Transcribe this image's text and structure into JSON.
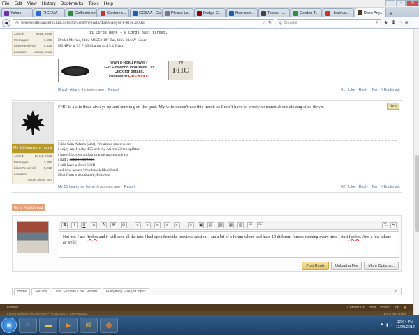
{
  "menubar": {
    "items": [
      "File",
      "Edit",
      "View",
      "History",
      "Bookmarks",
      "Tools",
      "Help"
    ]
  },
  "tabs": [
    {
      "label": "Yahoo",
      "color": "#6f2da8"
    },
    {
      "label": "RICEMA",
      "color": "#2a6ad8"
    },
    {
      "label": "Golftechi.net",
      "color": "#2f8d3a"
    },
    {
      "label": "Conferen...",
      "color": "#c0392b"
    },
    {
      "label": "GCSAA - Golf...",
      "color": "#1f5fa6"
    },
    {
      "label": "Please Lo...",
      "color": "#7a7a7a"
    },
    {
      "label": "Dodge C...",
      "color": "#8b0000"
    },
    {
      "label": "New cont...",
      "color": "#1f5fa6"
    },
    {
      "label": "Topics - ...",
      "color": "#444"
    },
    {
      "label": "Garden T...",
      "color": "#2f8d3a"
    },
    {
      "label": "Health.c...",
      "color": "#c0392b"
    },
    {
      "label": "Does Any...",
      "color": "#4f3a21",
      "active": true
    }
  ],
  "navbar": {
    "url": "firewoodhoardersclub.com/forums/threads/does-anyone-else.8082/",
    "search_placeholder": "Google"
  },
  "post_top": {
    "stats": [
      {
        "label": "Joined:",
        "value": "Oct 3, 2013"
      },
      {
        "label": "Messages:",
        "value": "7,605"
      },
      {
        "label": "Likes Received:",
        "value": "9,436"
      },
      {
        "label": "Location:",
        "value": "Lakota, Iowa"
      }
    ],
    "sig_lines": [
      "11 Cords done - 0 Cords past target.",
      "Drolet Myriad, Stihl MS250 18\" Bar, Stihl 034AV Super",
      "HENRY- a '99 F-150 Lariat 4x4 5.4 Triton"
    ],
    "banner": {
      "line1": "Own a Roku Player?",
      "line2": "Get Firewood Hoarders TV!",
      "line3": "Click for details.",
      "code_label": "codeword:",
      "code": "FIREWOOD",
      "tv_text": "TV",
      "fhc_text": "FHC"
    },
    "author": "Grizzly Adam",
    "time": "8 minutes ago",
    "report": "Report",
    "post_number": "#1",
    "like": "Like",
    "reply": "Reply",
    "top": "Top",
    "bookmark": "Bookmark"
  },
  "post_mid": {
    "username": "My 15 hearts my home",
    "stats": [
      {
        "label": "Joined:",
        "value": "Dec 1, 2013"
      },
      {
        "label": "Messages:",
        "value": "3,596"
      },
      {
        "label": "Likes Received:",
        "value": "5,213"
      },
      {
        "label": "Location:",
        "value": ""
      }
    ],
    "location_value": "South Shore, MA",
    "badge_new": "New",
    "body": "FHC is a site thats always up and running on the ipad. My wife doesn't use this much so I don't have to worry so much about closing sites down.",
    "sig_lines": [
      "I like Sam Adams (alot), I'm also a shareholder",
      "I enjoy my Husky 455 and my Ariens 22 ton splitter",
      "I have 2 boxers and an orange marmalade cat",
      "I had a Jotul F500 Oslo",
      "I still have a Jotul 602B",
      "and now have a Woodstock Ideal Steel",
      "Heat from a woodstove; Priceless"
    ],
    "author": "My 15 hearts my home",
    "time": "A moment ago",
    "report": "Report",
    "post_number": "#2",
    "like": "Like",
    "reply": "Reply",
    "top": "Top",
    "bookmark": "Bookmark"
  },
  "go_first": "Go to First Unread",
  "editor": {
    "toolbar": [
      "B",
      "I",
      "U",
      "A",
      "A",
      "⌘",
      "⊘",
      "≡",
      "≡",
      "≡",
      "≡",
      "≡",
      "☺",
      "▣",
      "▤",
      "▥",
      "▦",
      "▧",
      "↶",
      "↷"
    ],
    "text_a": "Not me. I use ",
    "spell1": "firefox",
    "text_b": " and it will save all the tabs I had open from the previous session. I am a bit of a forum whore and have 10 different forums running every time I start ",
    "spell2": "firefox",
    "text_c": ". And a few others as well.",
    "post_reply": "Post Reply",
    "upload": "Upload a File",
    "more": "More Options..."
  },
  "breadcrumb": [
    "Home",
    "Forums",
    "The \"Fireside Chat\" Rooms",
    "Everything Else (off topic)"
  ],
  "footer": {
    "left": "Default",
    "links": [
      "Contact Us",
      "Help",
      "Home",
      "Top"
    ],
    "copyright": "Forum software by XenForo™ ©2010-2014 XenForo Ltd.",
    "terms": "Terms and Rules"
  },
  "taskbar": {
    "time": "12:04 PM",
    "date": "11/29/2014"
  }
}
